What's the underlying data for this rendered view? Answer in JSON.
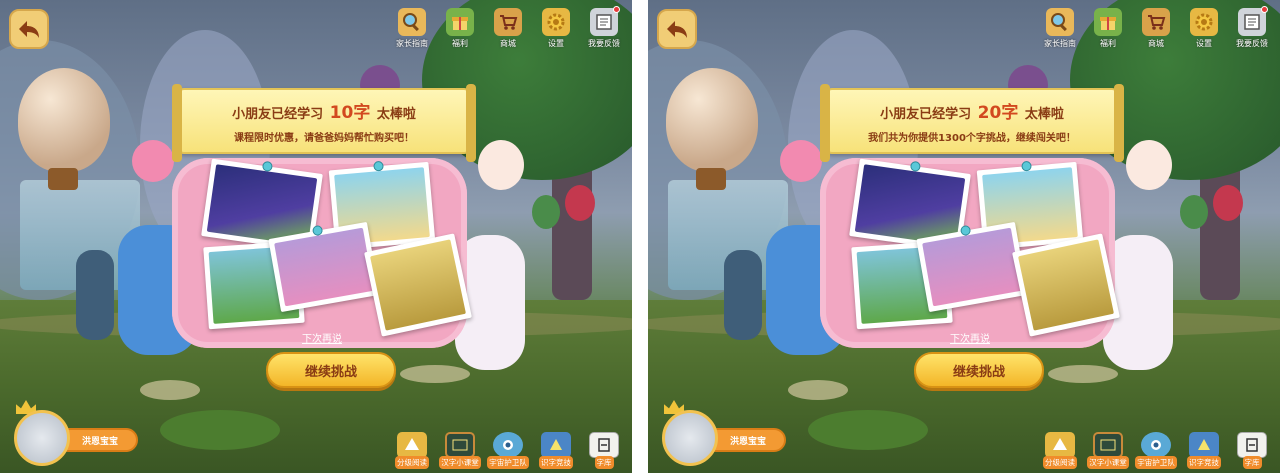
{
  "topbar": {
    "items": [
      {
        "label": "家长指南",
        "icon": "magnifier-icon"
      },
      {
        "label": "福利",
        "icon": "gift-icon"
      },
      {
        "label": "商城",
        "icon": "cart-icon"
      },
      {
        "label": "设置",
        "icon": "gear-icon"
      },
      {
        "label": "我要反馈",
        "icon": "feedback-icon"
      }
    ]
  },
  "panels": [
    {
      "banner": {
        "prefix": "小朋友已经学习",
        "count": "10字",
        "suffix": "太棒啦",
        "line2": "课程限时优惠，请爸爸妈妈帮忙购买吧！"
      }
    },
    {
      "banner": {
        "prefix": "小朋友已经学习",
        "count": "20字",
        "suffix": "太棒啦",
        "line2": "我们共为你提供1300个字挑战，继续闯关吧！"
      }
    }
  ],
  "actions": {
    "later_label": "下次再说",
    "continue_label": "继续挑战"
  },
  "profile": {
    "name": "洪恩宝宝"
  },
  "bottom_nav": {
    "items": [
      {
        "label": "分级阅读",
        "icon": "reading-icon"
      },
      {
        "label": "汉字小课堂",
        "icon": "classroom-icon"
      },
      {
        "label": "宇宙护卫队",
        "icon": "guard-icon"
      },
      {
        "label": "识字竞技",
        "icon": "competition-icon"
      },
      {
        "label": "字库",
        "icon": "character-library-icon"
      }
    ]
  },
  "colors": {
    "banner_text": "#8a3c14",
    "accent_orange": "#f39a33",
    "board_pink": "#f2a7c2",
    "button_yellow": "#f3b628"
  }
}
